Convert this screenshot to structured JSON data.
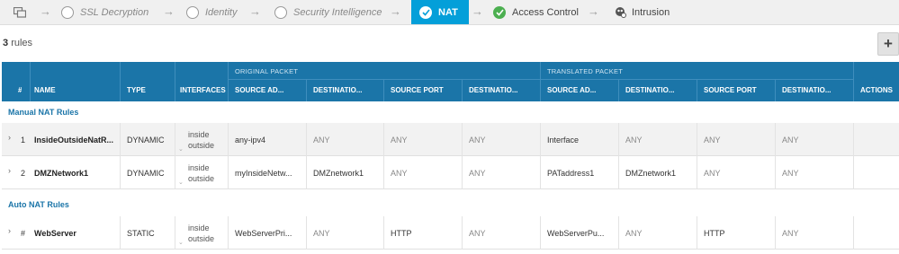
{
  "pipeline": {
    "steps": [
      {
        "label": "SSL Decryption",
        "state": "pending"
      },
      {
        "label": "Identity",
        "state": "pending"
      },
      {
        "label": "Security Intelligence",
        "state": "pending"
      },
      {
        "label": "NAT",
        "state": "active"
      },
      {
        "label": "Access Control",
        "state": "done"
      },
      {
        "label": "Intrusion",
        "state": "info"
      }
    ]
  },
  "rules_count": "3",
  "rules_label": "rules",
  "add_label": "+",
  "table": {
    "headers": {
      "num": "#",
      "name": "NAME",
      "type": "TYPE",
      "interfaces": "INTERFACES",
      "original_group": "ORIGINAL PACKET",
      "translated_group": "TRANSLATED PACKET",
      "orig_src_addr": "SOURCE AD...",
      "orig_dst_addr": "DESTINATIO...",
      "orig_src_port": "SOURCE PORT",
      "orig_dst_port": "DESTINATIO...",
      "trans_src_addr": "SOURCE AD...",
      "trans_dst_addr": "DESTINATIO...",
      "trans_src_port": "SOURCE PORT",
      "trans_dst_port": "DESTINATIO...",
      "actions": "ACTIONS"
    },
    "sections": [
      {
        "title": "Manual NAT Rules",
        "rows": [
          {
            "num": "1",
            "name": "InsideOutsideNatR...",
            "type": "DYNAMIC",
            "iface_in": "inside",
            "iface_out": "outside",
            "orig_src_addr": "any-ipv4",
            "orig_dst_addr": "ANY",
            "orig_src_port": "ANY",
            "orig_dst_port": "ANY",
            "trans_src_addr": "Interface",
            "trans_dst_addr": "ANY",
            "trans_src_port": "ANY",
            "trans_dst_port": "ANY"
          },
          {
            "num": "2",
            "name": "DMZNetwork1",
            "type": "DYNAMIC",
            "iface_in": "inside",
            "iface_out": "outside",
            "orig_src_addr": "myInsideNetw...",
            "orig_dst_addr": "DMZnetwork1",
            "orig_src_port": "ANY",
            "orig_dst_port": "ANY",
            "trans_src_addr": "PATaddress1",
            "trans_dst_addr": "DMZnetwork1",
            "trans_src_port": "ANY",
            "trans_dst_port": "ANY"
          }
        ]
      },
      {
        "title": "Auto NAT Rules",
        "rows": [
          {
            "num": "#",
            "name": "WebServer",
            "type": "STATIC",
            "iface_in": "inside",
            "iface_out": "outside",
            "orig_src_addr": "WebServerPri...",
            "orig_dst_addr": "ANY",
            "orig_src_port": "HTTP",
            "orig_dst_port": "ANY",
            "trans_src_addr": "WebServerPu...",
            "trans_dst_addr": "ANY",
            "trans_src_port": "HTTP",
            "trans_dst_port": "ANY"
          }
        ]
      }
    ]
  },
  "colors": {
    "header": "#1b75a8",
    "active_step": "#049fd9",
    "section_title": "#1b75a8",
    "done_check": "#4caf50"
  }
}
